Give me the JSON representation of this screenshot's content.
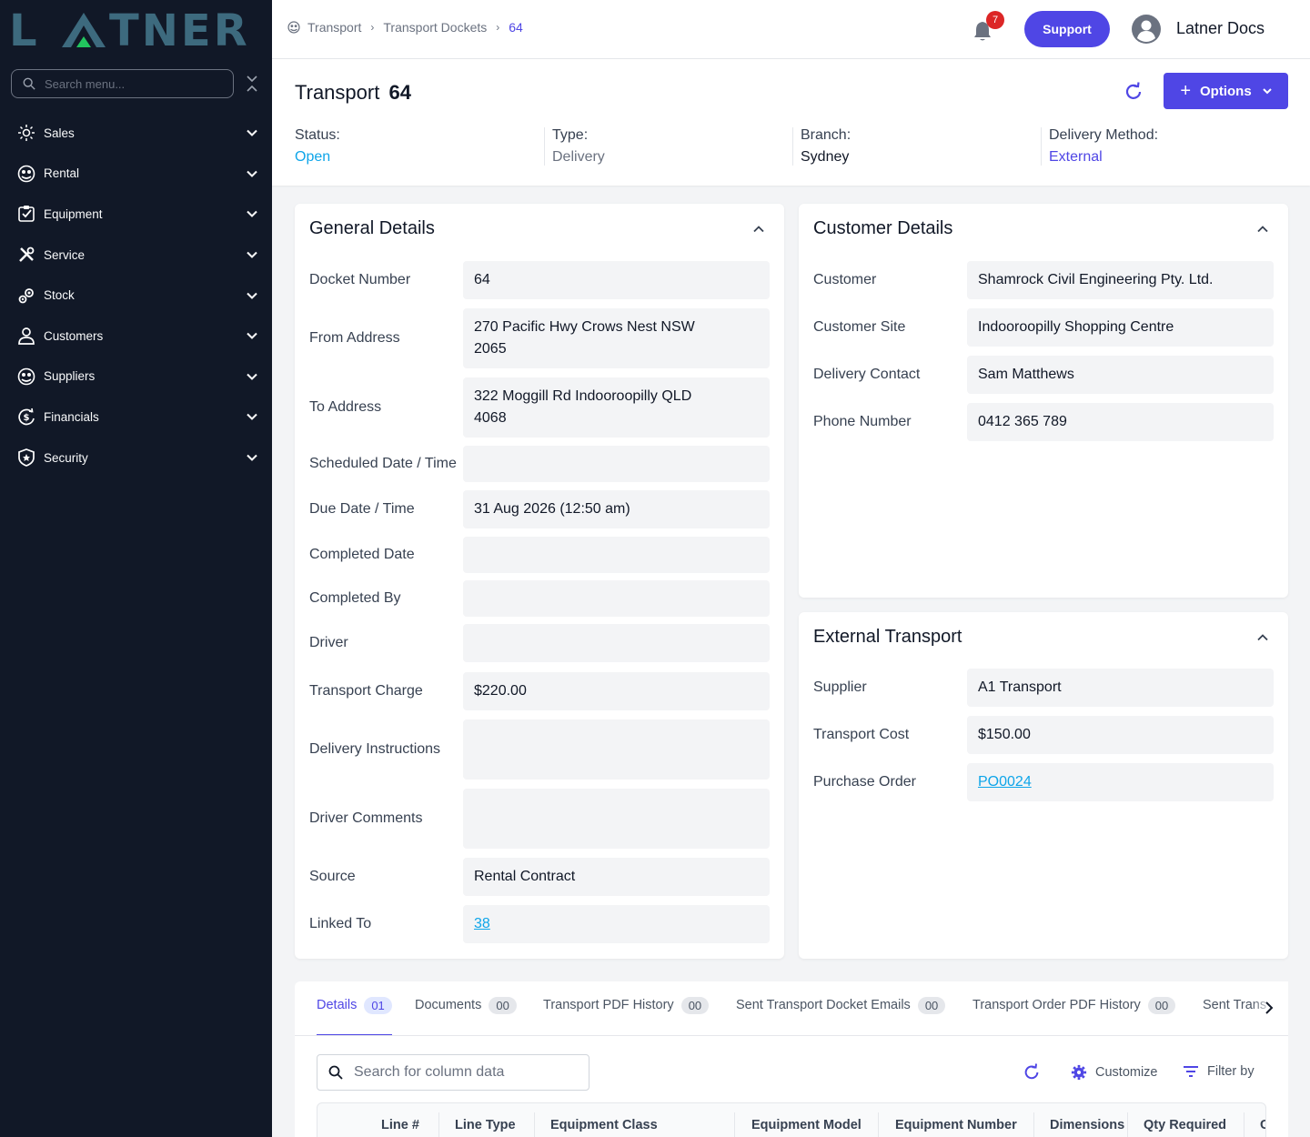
{
  "sidebar": {
    "logo_text": "LATNER",
    "search_placeholder": "Search menu...",
    "items": [
      {
        "label": "Sales",
        "icon": "sales-icon"
      },
      {
        "label": "Rental",
        "icon": "rental-icon"
      },
      {
        "label": "Equipment",
        "icon": "equipment-icon"
      },
      {
        "label": "Service",
        "icon": "service-icon"
      },
      {
        "label": "Stock",
        "icon": "stock-icon"
      },
      {
        "label": "Customers",
        "icon": "customers-icon"
      },
      {
        "label": "Suppliers",
        "icon": "suppliers-icon"
      },
      {
        "label": "Financials",
        "icon": "financials-icon"
      },
      {
        "label": "Security",
        "icon": "security-icon"
      }
    ]
  },
  "topbar": {
    "breadcrumbs": [
      "Transport",
      "Transport Dockets",
      "64"
    ],
    "notification_count": "7",
    "support_label": "Support",
    "user_name": "Latner Docs"
  },
  "header": {
    "title_prefix": "Transport",
    "title_number": "64",
    "options_label": "Options",
    "meta": [
      {
        "label": "Status:",
        "value": "Open",
        "color": "#0ea5e9"
      },
      {
        "label": "Type:",
        "value": "Delivery",
        "color": "#6b7280"
      },
      {
        "label": "Branch:",
        "value": "Sydney",
        "color": "#111827"
      },
      {
        "label": "Delivery Method:",
        "value": "External",
        "color": "#4f46e5"
      }
    ]
  },
  "general": {
    "title": "General Details",
    "rows": [
      {
        "label": "Docket Number",
        "value": "64"
      },
      {
        "label": "From Address",
        "value": "270 Pacific Hwy Crows Nest NSW 2065"
      },
      {
        "label": "To Address",
        "value": "322 Moggill Rd Indooroopilly QLD 4068"
      },
      {
        "label": "Scheduled Date / Time",
        "value": ""
      },
      {
        "label": "Due Date / Time",
        "value": "31 Aug 2026 (12:50 am)"
      },
      {
        "label": "Completed Date",
        "value": ""
      },
      {
        "label": "Completed By",
        "value": ""
      },
      {
        "label": "Driver",
        "value": ""
      },
      {
        "label": "Transport Charge",
        "value": "$220.00"
      },
      {
        "label": "Delivery Instructions",
        "value": ""
      },
      {
        "label": "Driver Comments",
        "value": ""
      },
      {
        "label": "Source",
        "value": "Rental Contract"
      },
      {
        "label": "Linked To",
        "value": "38"
      }
    ]
  },
  "customer": {
    "title": "Customer Details",
    "rows": [
      {
        "label": "Customer",
        "value": "Shamrock Civil Engineering Pty. Ltd."
      },
      {
        "label": "Customer Site",
        "value": "Indooroopilly Shopping Centre"
      },
      {
        "label": "Delivery Contact",
        "value": "Sam Matthews"
      },
      {
        "label": "Phone Number",
        "value": "0412 365 789"
      }
    ]
  },
  "external": {
    "title": "External Transport",
    "rows": [
      {
        "label": "Supplier",
        "value": "A1 Transport"
      },
      {
        "label": "Transport Cost",
        "value": "$150.00"
      },
      {
        "label": "Purchase Order",
        "value": "PO0024"
      }
    ]
  },
  "tabs": [
    {
      "label": "Details",
      "count": "01"
    },
    {
      "label": "Documents",
      "count": "00"
    },
    {
      "label": "Transport PDF History",
      "count": "00"
    },
    {
      "label": "Sent Transport Docket Emails",
      "count": "00"
    },
    {
      "label": "Transport Order PDF History",
      "count": "00"
    },
    {
      "label": "Sent Trans",
      "count": ""
    }
  ],
  "table": {
    "search_placeholder": "Search for column data",
    "customize_label": "Customize",
    "filter_label": "Filter by",
    "columns": [
      "Line #",
      "Line Type",
      "Equipment Class",
      "Equipment Model",
      "Equipment Number",
      "Dimensions",
      "Qty Required",
      "C"
    ]
  },
  "colors": {
    "accent": "#4f46e5",
    "sidebar_bg": "#111827",
    "link": "#0ea5e9",
    "badge": "#dc2626"
  }
}
